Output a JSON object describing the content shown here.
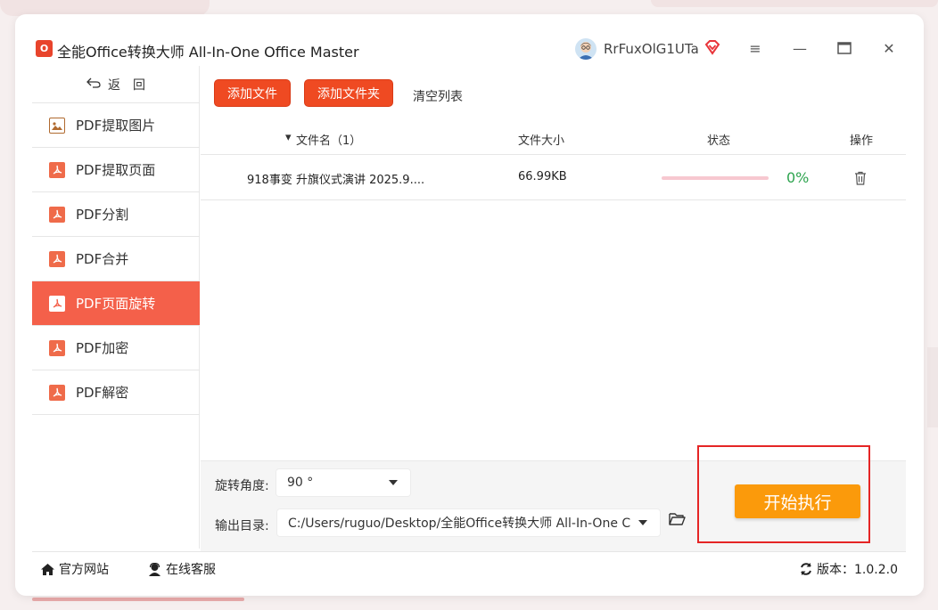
{
  "app": {
    "title": "全能Office转换大师 All-In-One Office Master",
    "logo_letter": "O",
    "username": "RrFuxOlG1UTa"
  },
  "window_controls": {
    "menu": "≡",
    "minimize": "—",
    "maximize": "□",
    "close": "✕"
  },
  "sidebar": {
    "back_label": "返　回",
    "items": [
      {
        "label": "PDF提取图片",
        "icon": "image-icon",
        "active": false
      },
      {
        "label": "PDF提取页面",
        "icon": "pdf-icon",
        "active": false
      },
      {
        "label": "PDF分割",
        "icon": "pdf-icon",
        "active": false
      },
      {
        "label": "PDF合并",
        "icon": "pdf-icon",
        "active": false
      },
      {
        "label": "PDF页面旋转",
        "icon": "pdf-icon",
        "active": true
      },
      {
        "label": "PDF加密",
        "icon": "pdf-icon",
        "active": false
      },
      {
        "label": "PDF解密",
        "icon": "pdf-icon",
        "active": false
      }
    ]
  },
  "toolbar": {
    "add_file": "添加文件",
    "add_folder": "添加文件夹",
    "clear_list": "清空列表"
  },
  "table": {
    "headers": {
      "filename": "文件名（1）",
      "filesize": "文件大小",
      "status": "状态",
      "action": "操作"
    },
    "rows": [
      {
        "filename": "918事变 升旗仪式演讲 2025.9....",
        "filesize": "66.99KB",
        "progress": 0,
        "percent": "0%"
      }
    ]
  },
  "options": {
    "rotate_label": "旋转角度:",
    "rotate_value": "90 °",
    "output_label": "输出目录:",
    "output_value": "C:/Users/ruguo/Desktop/全能Office转换大师 All-In-One C"
  },
  "start_button": "开始执行",
  "footer": {
    "website": "官方网站",
    "support": "在线客服",
    "version": "版本：1.0.2.0"
  },
  "colors": {
    "accent": "#f4604a",
    "button_red": "#ef4a22",
    "start_orange": "#fb9a0b",
    "highlight_red": "#e52525",
    "percent_green": "#2ea44f"
  }
}
